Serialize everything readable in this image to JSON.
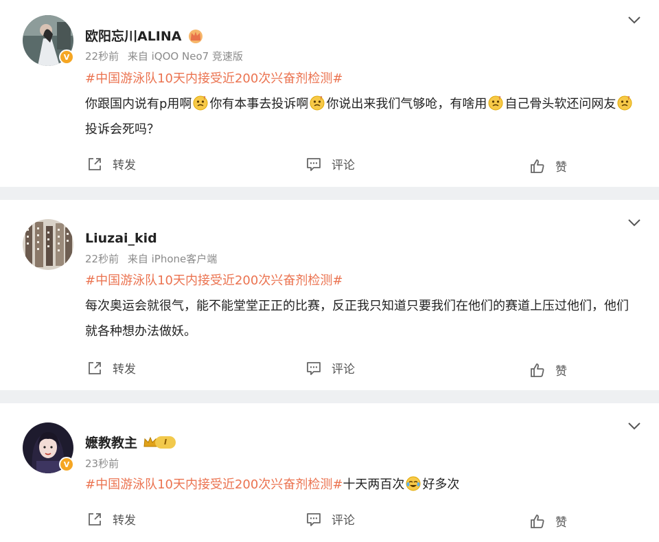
{
  "posts": [
    {
      "username": "欧阳忘川ALINA",
      "time": "22秒前",
      "source": "来自 iQOO Neo7 竞速版",
      "topic": "#中国游泳队10天内接受近200次兴奋剂检测#",
      "text_parts": [
        "你跟国内说有p用啊",
        "你有本事去投诉啊",
        "你说出来我们气够呛，有啥用",
        "自己骨头软还问网友",
        "投诉会死吗？"
      ],
      "emoji": "thinking-face-emoji"
    },
    {
      "username": "Liuzai_kid",
      "time": "22秒前",
      "source": "来自 iPhone客户端",
      "topic": "#中国游泳队10天内接受近200次兴奋剂检测#",
      "text": "每次奥运会就很气，能不能堂堂正正的比赛，反正我只知道只要我们在他们的赛道上压过他们，他们就各种想办法做妖。"
    },
    {
      "username": "嬷教教主",
      "time": "23秒前",
      "topic": "#中国游泳队10天内接受近200次兴奋剂检测#",
      "text_parts": [
        "十天两百次",
        "好多次"
      ],
      "emoji": "crying-laughing-emoji",
      "level_badge": "I"
    }
  ],
  "actions": {
    "forward": "转发",
    "comment": "评论",
    "like": "赞"
  },
  "verified_badge": "V",
  "colors": {
    "topic": "#eb7350",
    "background": "#eef0f2",
    "badge": "#f5a623"
  }
}
